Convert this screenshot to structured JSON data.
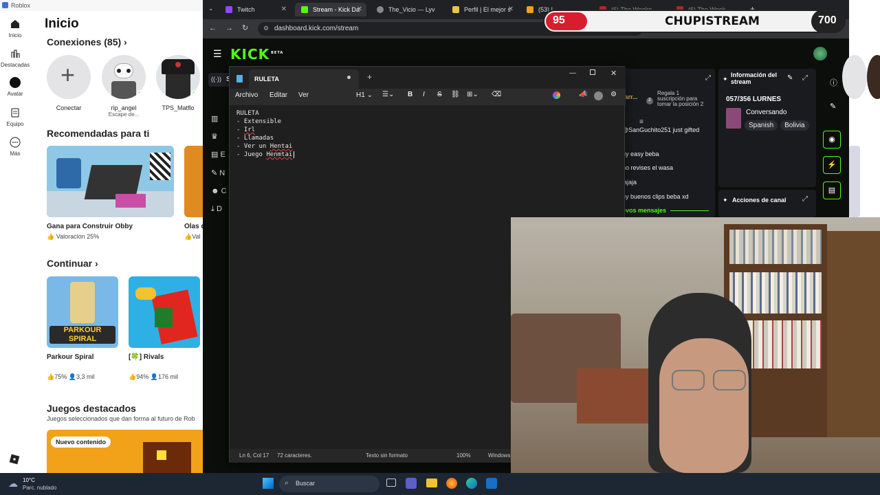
{
  "roblox": {
    "window_title": "Roblox",
    "nav": [
      {
        "label": "Inicio",
        "icon": "home-icon"
      },
      {
        "label": "Destacadas",
        "icon": "chart-icon"
      },
      {
        "label": "Avatar",
        "icon": "avatar-icon"
      },
      {
        "label": "Equipo",
        "icon": "inventory-icon"
      },
      {
        "label": "Más",
        "icon": "more-icon"
      }
    ],
    "heading": "Inicio",
    "connections_title": "Conexiones (85)",
    "connections": [
      {
        "name": "Conectar",
        "status": ""
      },
      {
        "name": "rip_angel",
        "status": "Escape de..."
      },
      {
        "name": "TPS_Matflo",
        "status": ""
      }
    ],
    "recommended_title": "Recomendadas para ti",
    "recommended": [
      {
        "title": "Gana para Construir Obby",
        "meta": "Valoración 25%"
      },
      {
        "title": "Olas d",
        "meta": "Val"
      }
    ],
    "continue_title": "Continuar",
    "continue": [
      {
        "title": "Parkour Spiral",
        "logo": "PARKOUR SPIRAL",
        "rating": "75%",
        "players": "3,3 mil"
      },
      {
        "title": "[🍀] Rivals",
        "rating": "94%",
        "players": "176 mil"
      }
    ],
    "featured_title": "Juegos destacados",
    "featured_sub": "Juegos seleccionados que dan forma al futuro de Rob",
    "featured_badge": "Nuevo contenido"
  },
  "browser": {
    "tabs": [
      {
        "label": "Twitch",
        "color": "#9146ff"
      },
      {
        "label": "Stream - Kick Da",
        "color": "#53fc18"
      },
      {
        "label": "The_Vicio — Lyv",
        "color": "#888888"
      },
      {
        "label": "Perfil | El mejor s",
        "color": "#e8c547"
      },
      {
        "label": "(53) I",
        "color": "#f0a020"
      },
      {
        "label": "(6) The Weekn",
        "color": "#ff3333"
      },
      {
        "label": "(6) The Week",
        "color": "#ff3333"
      }
    ],
    "url": "dashboard.kick.com/stream"
  },
  "kick": {
    "logo": "KICK",
    "logo_badge": "BETA",
    "side_items": [
      "Se",
      "",
      "",
      "E",
      "N",
      "C",
      "D"
    ],
    "goal_text": "Regala 1 suscripción para tomar la posición 2",
    "goal_name": "Barr...",
    "chat": [
      "@SanGuchito251 just gifted",
      "uy easy beba",
      "no revises el wasa",
      "jajaja",
      "uy buenos clips beba xd"
    ],
    "new_messages": "evos mensajes",
    "stream_info_title": "Información del stream",
    "stream_title": "057/356 LURNES",
    "category": "Conversando",
    "tags": [
      "Spanish",
      "Bolivia"
    ],
    "channel_actions_title": "Acciones de canal"
  },
  "overlay": {
    "hp_value": "95",
    "name": "CHUPISTREAM",
    "score": "700"
  },
  "notepad": {
    "tab_title": "RULETA",
    "menu": [
      "Archivo",
      "Editar",
      "Ver"
    ],
    "heading_select": "H1",
    "lines": [
      "RULETA",
      "- Extensible",
      "- ",
      "Irl",
      "- Llamadas",
      "- Ver un ",
      "Hentai",
      "- Juego ",
      "Henmtai"
    ],
    "status": {
      "position": "Ln 6, Col 17",
      "chars": "72 caracteres.",
      "format": "Texto sin formato",
      "zoom": "100%",
      "eol": "Windows"
    }
  },
  "taskbar": {
    "temp": "10°C",
    "weather": "Parc. nublado",
    "search": "Buscar"
  }
}
